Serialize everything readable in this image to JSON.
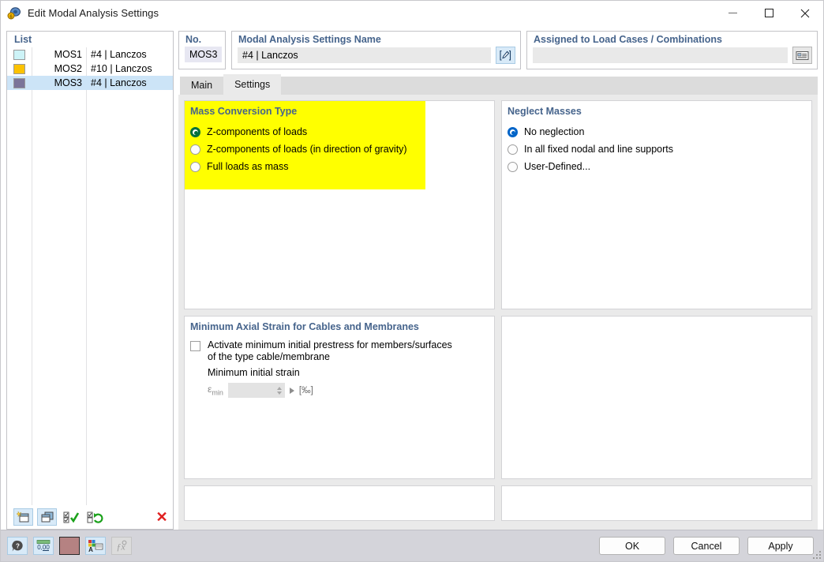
{
  "window": {
    "title": "Edit Modal Analysis Settings",
    "icon": "modal-analysis-icon",
    "minimize_label": "–",
    "maximize_label": "□",
    "close_label": "✕"
  },
  "list_panel": {
    "header": "List",
    "rows": [
      {
        "color": "#cdf3f7",
        "id": "MOS1",
        "desc": "#4 | Lanczos",
        "selected": false
      },
      {
        "color": "#fcc200",
        "id": "MOS2",
        "desc": "#10 | Lanczos",
        "selected": false
      },
      {
        "color": "#7b7499",
        "id": "MOS3",
        "desc": "#4 | Lanczos",
        "selected": true
      }
    ],
    "toolbar": {
      "new_label": "new-icon",
      "copy_label": "copy-icon",
      "select_all_label": "select-all-icon",
      "invert_selection_label": "invert-selection-icon",
      "delete_label": "✕"
    }
  },
  "no_group": {
    "title": "No.",
    "value": "MOS3"
  },
  "name_group": {
    "title": "Modal Analysis Settings Name",
    "value": "#4 | Lanczos",
    "edit_button": "edit-name-icon"
  },
  "assigned_group": {
    "title": "Assigned to Load Cases / Combinations",
    "value": "",
    "placeholder": "",
    "picker_button": "list-picker-icon"
  },
  "tabs": [
    {
      "label": "Main",
      "active": false
    },
    {
      "label": "Settings",
      "active": true
    }
  ],
  "mass_conversion": {
    "title": "Mass Conversion Type",
    "highlight_color": "#ffff00",
    "selected_color": "#00703c",
    "options": [
      {
        "label": "Z-components of loads",
        "selected": true
      },
      {
        "label": "Z-components of loads (in direction of gravity)",
        "selected": false
      },
      {
        "label": "Full loads as mass",
        "selected": false
      }
    ]
  },
  "neglect_masses": {
    "title": "Neglect Masses",
    "selected_color": "#0064c8",
    "options": [
      {
        "label": "No neglection",
        "selected": true
      },
      {
        "label": "In all fixed nodal and line supports",
        "selected": false
      },
      {
        "label": "User-Defined...",
        "selected": false
      }
    ]
  },
  "min_axial_strain": {
    "title": "Minimum Axial Strain for Cables and Membranes",
    "checkbox_label_line1": "Activate minimum initial prestress for members/surfaces",
    "checkbox_label_line2": "of the type cable/membrane",
    "checked": false,
    "sub_label": "Minimum initial strain",
    "field_symbol": "ε",
    "field_subscript": "min",
    "field_value": "",
    "unit": "[‰]"
  },
  "footer": {
    "icons": [
      {
        "name": "help-icon",
        "glyph": "?"
      },
      {
        "name": "decimal-places-icon",
        "glyph": "0,00"
      },
      {
        "name": "color-swatch-icon",
        "glyph": "",
        "color": "#b58282"
      },
      {
        "name": "display-properties-icon",
        "glyph": ""
      },
      {
        "name": "formula-icon",
        "glyph": "ƒx"
      }
    ],
    "buttons": [
      {
        "label": "OK",
        "name": "ok-button"
      },
      {
        "label": "Cancel",
        "name": "cancel-button"
      },
      {
        "label": "Apply",
        "name": "apply-button"
      }
    ]
  }
}
